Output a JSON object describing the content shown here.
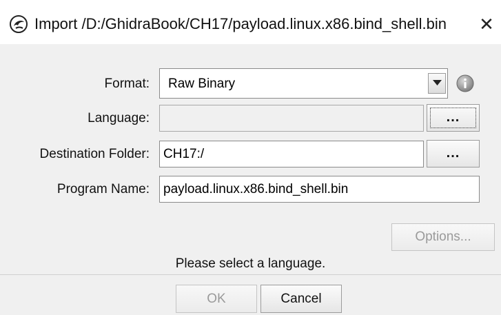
{
  "window": {
    "title": "Import /D:/GhidraBook/CH17/payload.linux.x86.bind_shell.bin",
    "close_glyph": "✕",
    "app_icon": "ghidra-dragon-icon"
  },
  "form": {
    "format": {
      "label": "Format:",
      "value": "Raw Binary",
      "icon": "info-icon"
    },
    "language": {
      "label": "Language:",
      "value": "",
      "browse_label": "..."
    },
    "destination": {
      "label": "Destination Folder:",
      "value": "CH17:/",
      "browse_label": "..."
    },
    "program_name": {
      "label": "Program Name:",
      "value": "payload.linux.x86.bind_shell.bin"
    }
  },
  "options_button": "Options...",
  "status_message": "Please select a language.",
  "buttons": {
    "ok": "OK",
    "cancel": "Cancel"
  }
}
